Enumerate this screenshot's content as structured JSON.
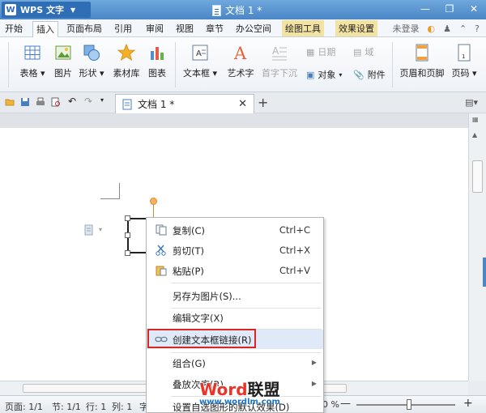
{
  "app": {
    "name": "WPS 文字",
    "doc_title": "文档 1 *"
  },
  "menu_tabs": [
    "开始",
    "插入",
    "页面布局",
    "引用",
    "审阅",
    "视图",
    "章节",
    "办公空间",
    "绘图工具",
    "效果设置"
  ],
  "menu_right": {
    "login": "未登录"
  },
  "ribbon": {
    "table": "表格",
    "picture": "图片",
    "shape": "形状",
    "material": "素材库",
    "chart": "图表",
    "textbox": "文本框",
    "wordart": "艺术字",
    "dropcap": "首字下沉",
    "date": "日期",
    "field": "域",
    "object": "对象",
    "attachment": "附件",
    "header_footer": "页眉和页脚",
    "page_number": "页码"
  },
  "doc_tab": {
    "label": "文档 1 *"
  },
  "context_menu": {
    "copy": {
      "label": "复制(C)",
      "key": "Ctrl+C"
    },
    "cut": {
      "label": "剪切(T)",
      "key": "Ctrl+X"
    },
    "paste": {
      "label": "粘贴(P)",
      "key": "Ctrl+V"
    },
    "save_as_picture": "另存为图片(S)...",
    "edit_text": "编辑文字(X)",
    "create_link": "创建文本框链接(R)",
    "group": "组合(G)",
    "order": "叠放次序(R)",
    "set_default": "设置自选图形的默认效果(D)"
  },
  "status": {
    "page": "页面: 1/1",
    "section": "节: 1/1",
    "row": "行: 1",
    "col": "列: 1",
    "extra": "字",
    "zoom": "0 %"
  },
  "zoom_level": 0.53,
  "watermark": {
    "main_prefix": "Word",
    "main_suffix": "联盟",
    "url": "www.wordlm.com"
  },
  "colors": {
    "title_blue": "#4a86c6",
    "highlight_red": "#d62626",
    "accent_orange": "#f4b35c"
  }
}
